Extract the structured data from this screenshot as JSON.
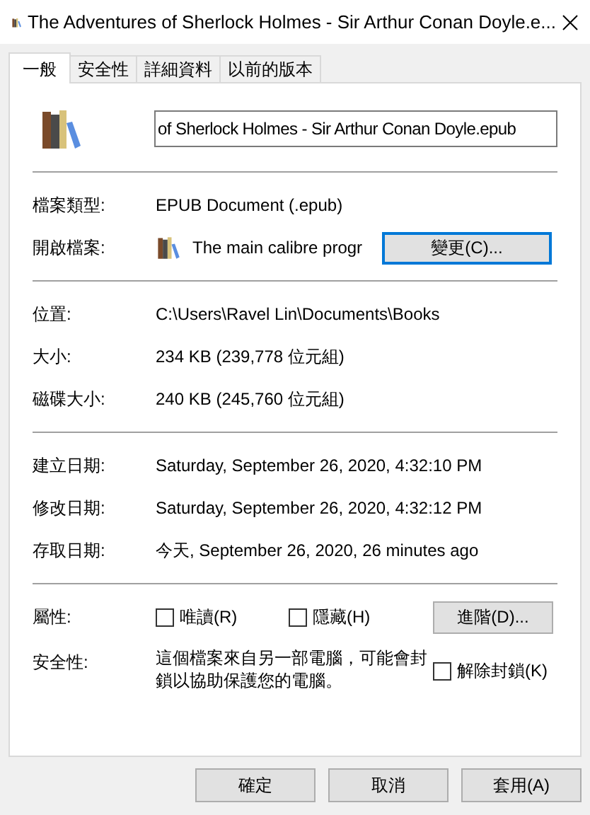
{
  "window": {
    "title": "The Adventures of Sherlock Holmes - Sir Arthur Conan Doyle.e..."
  },
  "tabs": [
    {
      "label": "一般",
      "selected": true
    },
    {
      "label": "安全性",
      "selected": false
    },
    {
      "label": "詳細資料",
      "selected": false
    },
    {
      "label": "以前的版本",
      "selected": false
    }
  ],
  "filename": {
    "value": "of Sherlock Holmes - Sir Arthur Conan Doyle.epub"
  },
  "file_type": {
    "label": "檔案類型:",
    "value": "EPUB Document (.epub)"
  },
  "opens_with": {
    "label": "開啟檔案:",
    "value": "The main calibre progr",
    "button": "變更(C)..."
  },
  "location_rows": [
    {
      "label": "位置:",
      "value": "C:\\Users\\Ravel Lin\\Documents\\Books"
    },
    {
      "label": "大小:",
      "value": "234 KB (239,778 位元組)"
    },
    {
      "label": "磁碟大小:",
      "value": "240 KB (245,760 位元組)"
    }
  ],
  "date_rows": [
    {
      "label": "建立日期:",
      "value": "Saturday, September 26, 2020, 4:32:10 PM"
    },
    {
      "label": "修改日期:",
      "value": "Saturday, September 26, 2020, 4:32:12 PM"
    },
    {
      "label": "存取日期:",
      "value": "今天, September 26, 2020, 26 minutes ago"
    }
  ],
  "attributes": {
    "label": "屬性:",
    "options": [
      {
        "label": "唯讀(R)",
        "checked": false
      },
      {
        "label": "隱藏(H)",
        "checked": false
      }
    ],
    "button": "進階(D)..."
  },
  "security": {
    "label": "安全性:",
    "text": "這個檔案來自另一部電腦，可能會封鎖以協助保護您的電腦。",
    "unblock": {
      "label": "解除封鎖(K)",
      "checked": false
    }
  },
  "buttons": [
    "確定",
    "取消",
    "套用(A)"
  ]
}
